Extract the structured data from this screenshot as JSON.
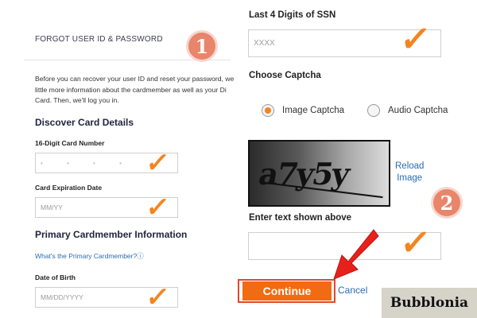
{
  "left": {
    "header": "FORGOT USER ID & PASSWORD",
    "intro_lines": [
      "Before you can recover your user ID and reset your password, we",
      "little more information about the cardmember as well as your Di",
      "Card. Then, we'll log you in."
    ],
    "discover_heading": "Discover Card Details",
    "card_number_label": "16-Digit Card Number",
    "card_number_value": "•  •  •  •",
    "expiration_label": "Card Expiration Date",
    "expiration_placeholder": "MM/YY",
    "primary_heading": "Primary Cardmember Information",
    "primary_link": "What's the Primary Cardmember?ⓘ",
    "dob_label": "Date of Birth",
    "dob_placeholder": "MM/DD/YYYY"
  },
  "right": {
    "ssn_label": "Last 4 Digits of SSN",
    "ssn_placeholder": "XXXX",
    "captcha_heading": "Choose Captcha",
    "captcha_options": [
      "Image Captcha",
      "Audio Captcha"
    ],
    "selected_captcha": "Image Captcha",
    "captcha_text": "a7y5y",
    "reload_label": [
      "Reload",
      "Image"
    ],
    "enter_text_label": "Enter text shown above",
    "continue_label": "Continue",
    "cancel_label": "Cancel"
  },
  "annotations": {
    "badge_1": "1",
    "badge_2": "2",
    "check_mark": "✓",
    "watermark": "Bubblonia"
  },
  "colors": {
    "accent_orange": "#f06b12",
    "link_blue": "#2b6cb0",
    "badge": "#e9856a",
    "arrow_red": "#e8201c"
  },
  "icons": [
    "check-icon",
    "radio-icon",
    "arrow-icon",
    "info-icon"
  ]
}
